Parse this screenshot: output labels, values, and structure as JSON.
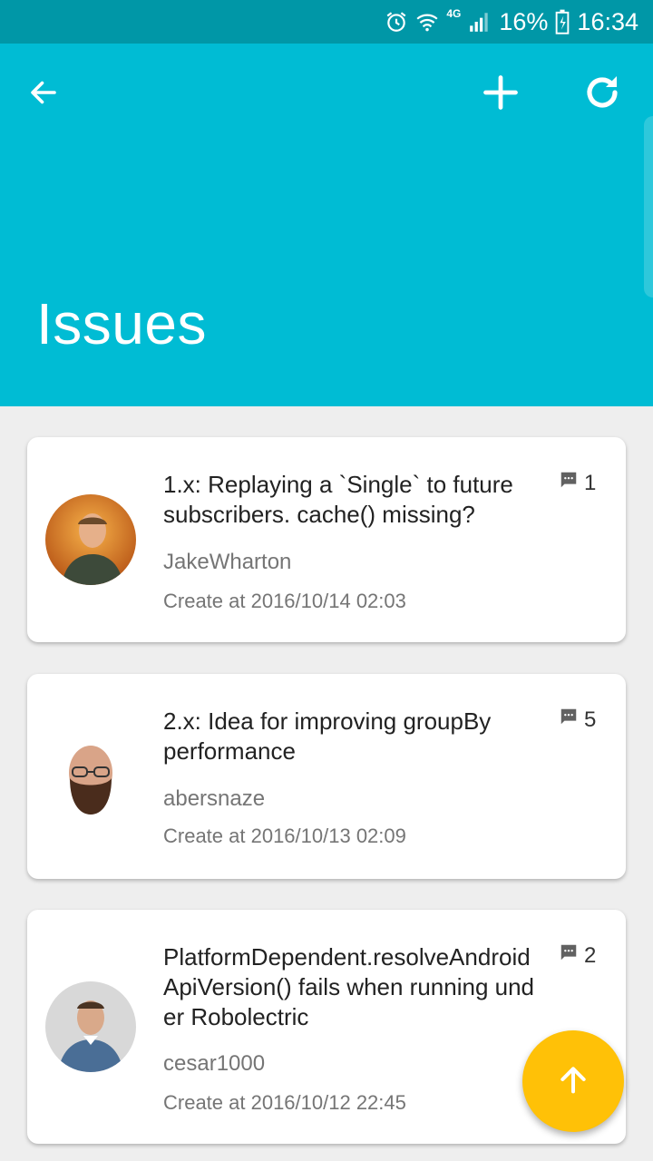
{
  "status_bar": {
    "network": "4G",
    "battery": "16%",
    "time": "16:34"
  },
  "app_bar": {
    "title": "Issues",
    "icons": [
      "back-arrow-icon",
      "add-icon",
      "refresh-icon"
    ]
  },
  "issues": [
    {
      "title": "1.x: Replaying a `Single` to future subscribers. cache() missing?",
      "author": "JakeWharton",
      "created": "Create at 2016/10/14 02:03",
      "comments": "1"
    },
    {
      "title": "2.x: Idea for improving groupBy performance",
      "author": "abersnaze",
      "created": "Create at 2016/10/13 02:09",
      "comments": "5"
    },
    {
      "title": "PlatformDependent.resolveAndroidApiVersion() fails when running under Robolectric",
      "author": "cesar1000",
      "created": "Create at 2016/10/12 22:45",
      "comments": "2"
    }
  ],
  "fab": {
    "icon": "arrow-up-icon"
  },
  "colors": {
    "status_bar": "#0097a7",
    "app_bar": "#00bcd4",
    "fab": "#ffc107",
    "background": "#eeeeee"
  }
}
